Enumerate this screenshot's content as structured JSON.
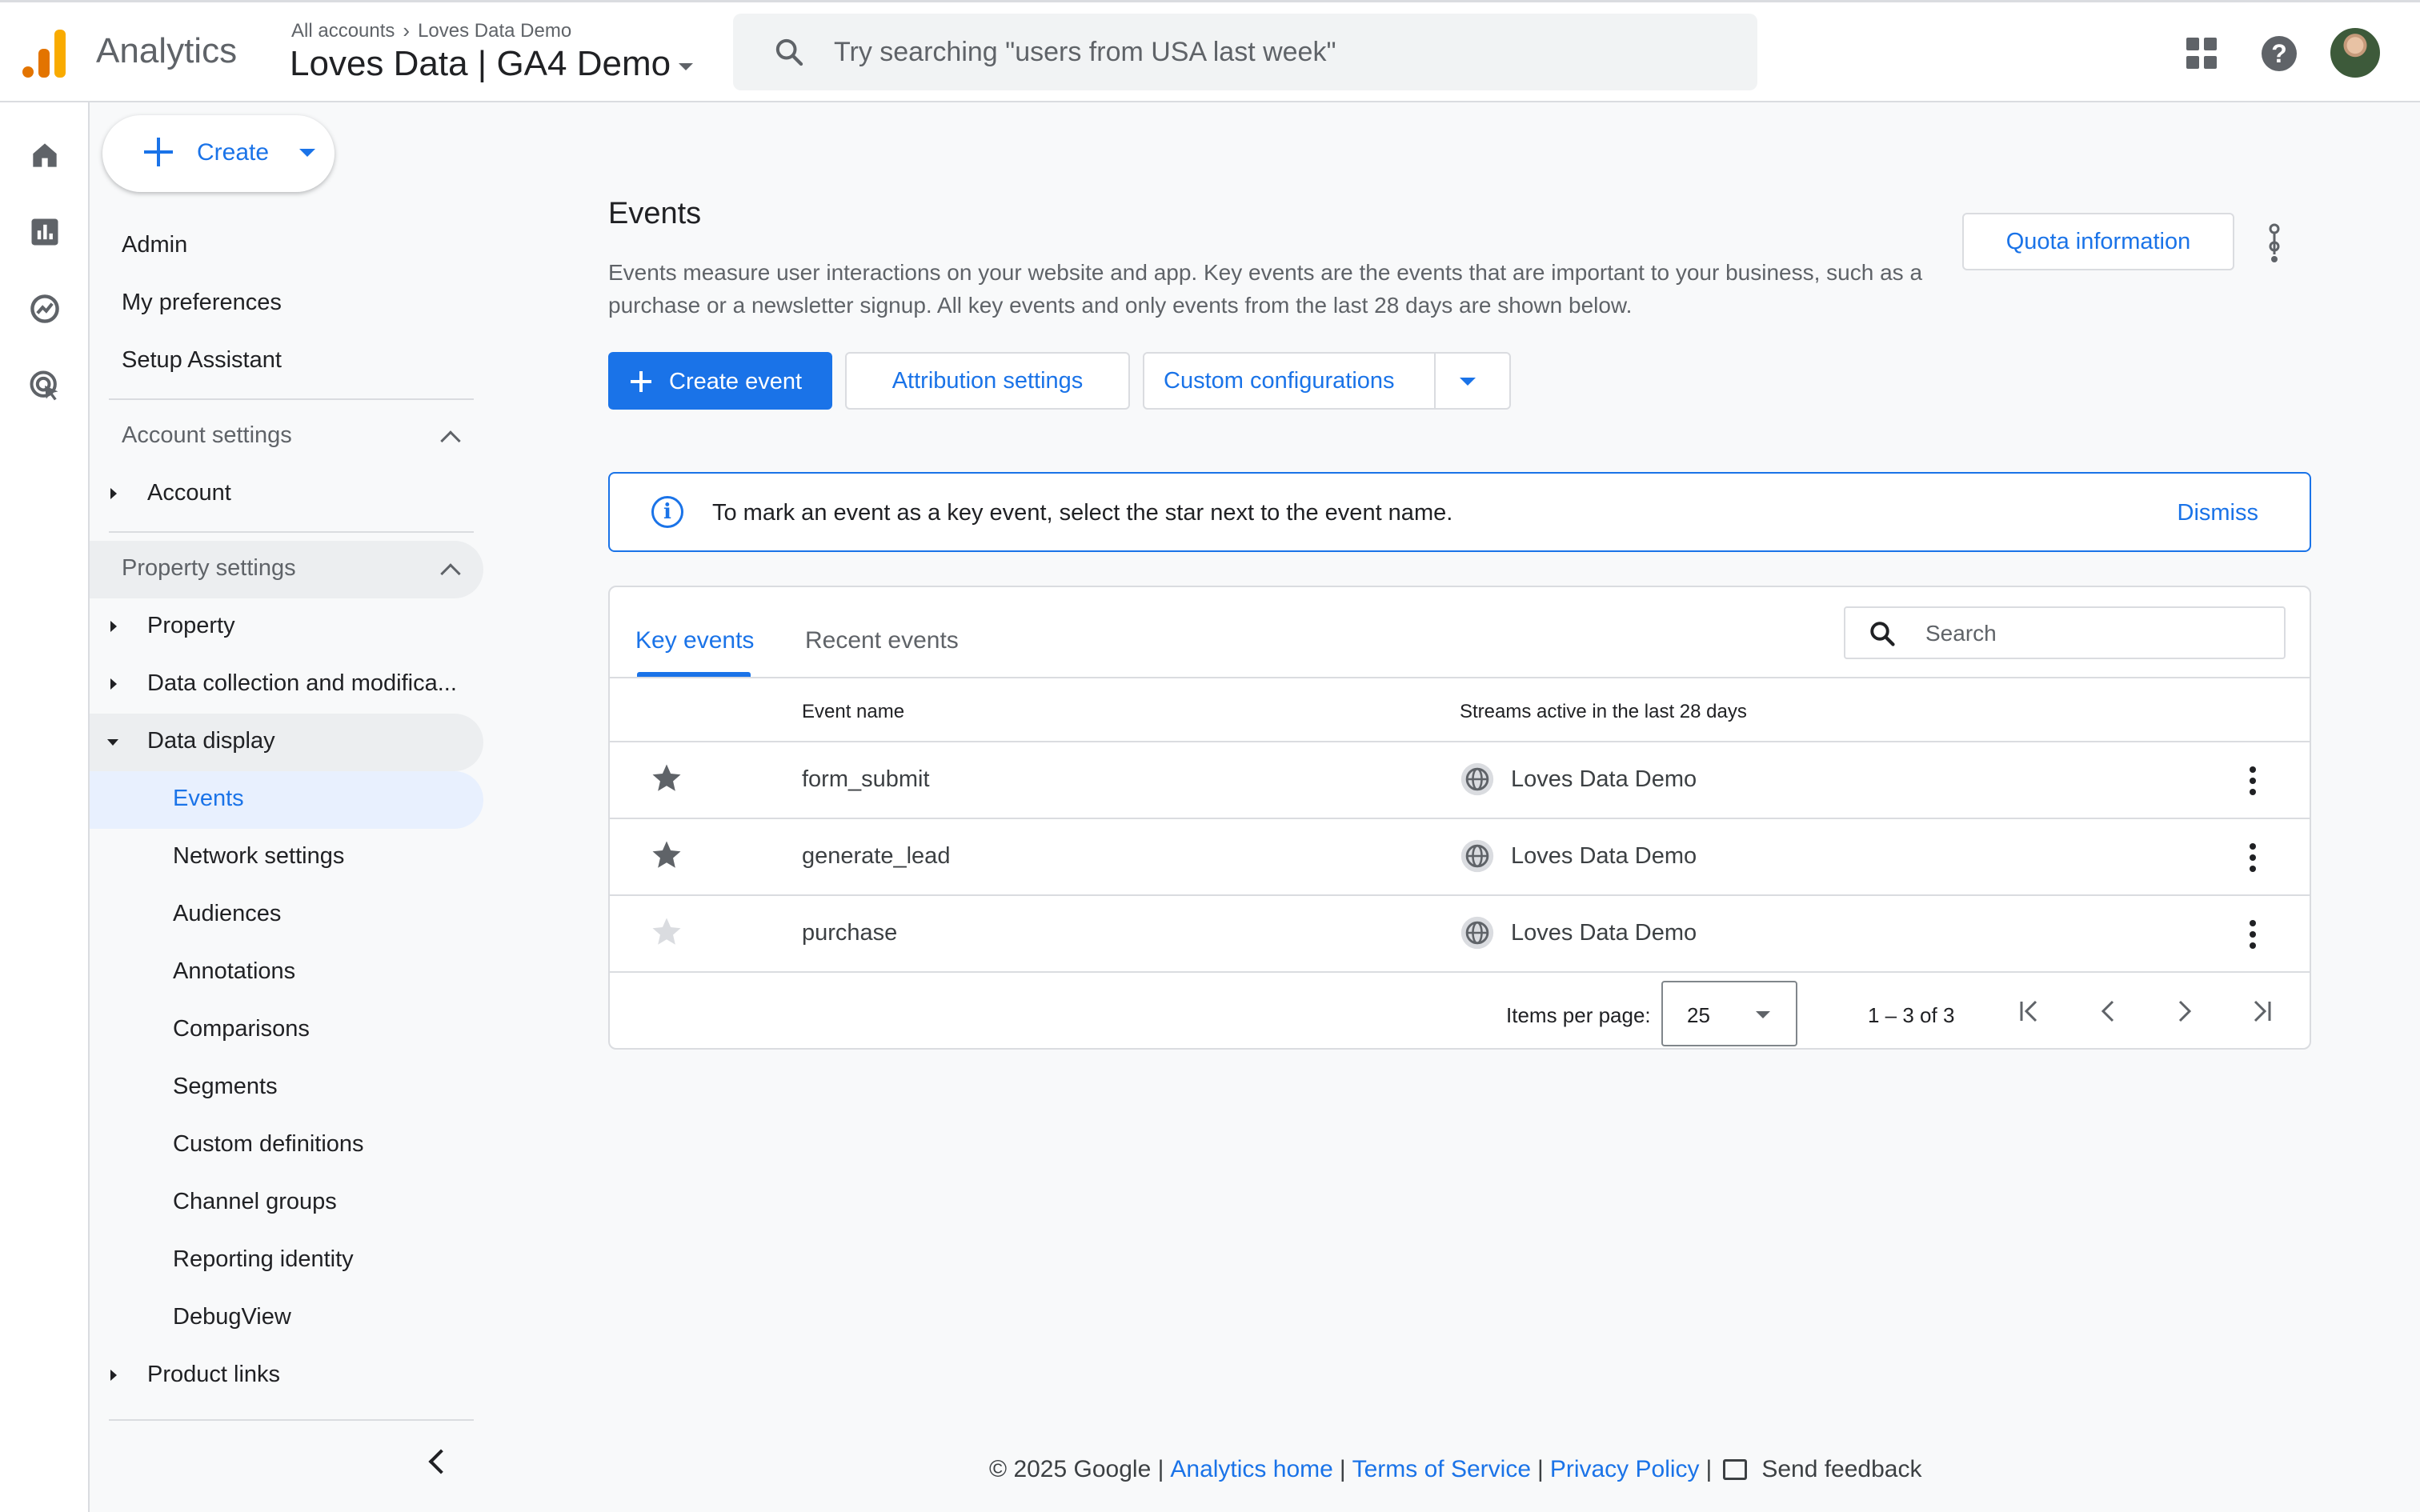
{
  "header": {
    "app_name": "Analytics",
    "breadcrumb_all": "All accounts",
    "breadcrumb_account": "Loves Data Demo",
    "property": "Loves Data | GA4 Demo",
    "search_placeholder": "Try searching \"users from USA last week\""
  },
  "sidebar": {
    "create_label": "Create",
    "top_items": [
      "Admin",
      "My preferences",
      "Setup Assistant"
    ],
    "account_settings": "Account settings",
    "account": "Account",
    "property_settings": "Property settings",
    "property": "Property",
    "data_collection": "Data collection and modifica...",
    "data_display": "Data display",
    "sub_items": [
      "Events",
      "Network settings",
      "Audiences",
      "Annotations",
      "Comparisons",
      "Segments",
      "Custom definitions",
      "Channel groups",
      "Reporting identity",
      "DebugView"
    ],
    "product_links": "Product links"
  },
  "main": {
    "title": "Events",
    "description": "Events measure user interactions on your website and app. Key events are the events that are important to your business, such as a purchase or a newsletter signup. All key events and only events from the last 28 days are shown below.",
    "quota_button": "Quota information",
    "create_event": "Create event",
    "attribution_settings": "Attribution settings",
    "custom_configurations": "Custom configurations",
    "info_banner": "To mark an event as a key event, select the star next to the event name.",
    "dismiss": "Dismiss"
  },
  "table": {
    "tabs": [
      "Key events",
      "Recent events"
    ],
    "search_placeholder": "Search",
    "columns": [
      "Event name",
      "Streams active in the last 28 days"
    ],
    "rows": [
      {
        "name": "form_submit",
        "stream": "Loves Data Demo",
        "key_event": true
      },
      {
        "name": "generate_lead",
        "stream": "Loves Data Demo",
        "key_event": true
      },
      {
        "name": "purchase",
        "stream": "Loves Data Demo",
        "key_event": false
      }
    ],
    "items_per_page_label": "Items per page:",
    "items_per_page": "25",
    "range": "1 – 3 of 3"
  },
  "footer": {
    "copyright": "© 2025 Google |",
    "analytics_home": "Analytics home",
    "terms": "Terms of Service",
    "privacy": "Privacy Policy",
    "feedback": "Send feedback",
    "sep": "|"
  },
  "colors": {
    "accent": "#1a73e8",
    "star_active": "#5f6368",
    "star_inactive": "#dadce0"
  }
}
